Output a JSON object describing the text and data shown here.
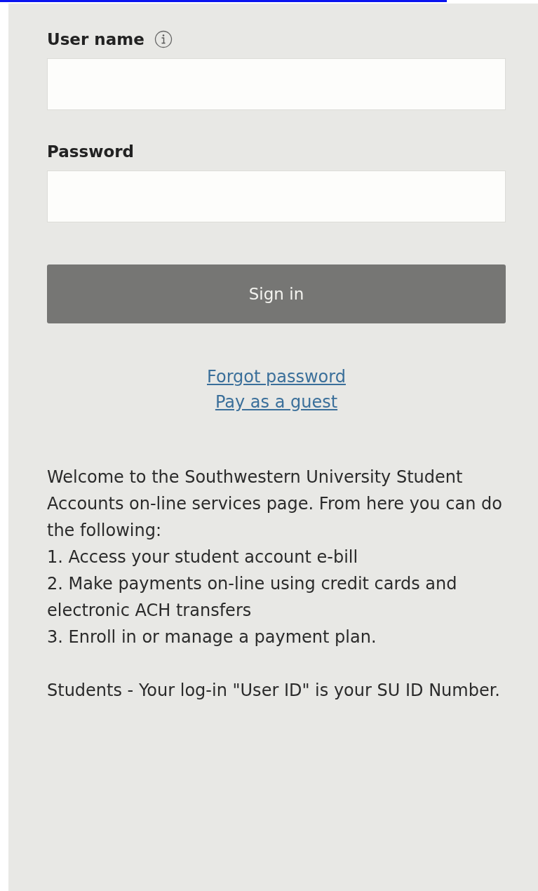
{
  "username": {
    "label": "User name",
    "info_icon": true
  },
  "password": {
    "label": "Password"
  },
  "sign_in_button": "Sign in",
  "links": [
    "Forgot password",
    "Pay as a guest"
  ],
  "intro": "Welcome to the Southwestern University Student Accounts on-line services page. From here you can do the following:",
  "steps": [
    "1. Access your student account e-bill",
    "2. Make payments on-line using credit cards and electronic ACH transfers",
    "3. Enroll in or manage a payment plan."
  ],
  "note": "Students - Your log-in \"User ID\"  is your SU ID Number."
}
